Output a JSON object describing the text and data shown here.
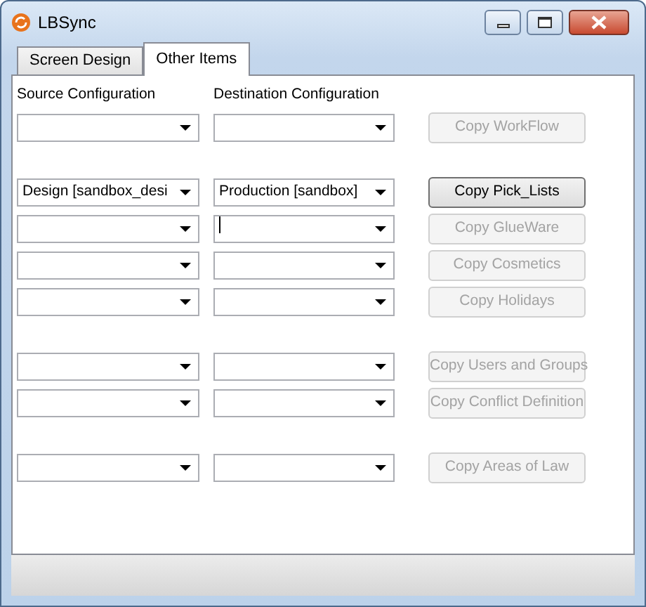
{
  "window": {
    "title": "LBSync"
  },
  "tabs": [
    {
      "label": "Screen Design",
      "selected": false
    },
    {
      "label": "Other Items",
      "selected": true
    }
  ],
  "column_headers": {
    "source": "Source Configuration",
    "destination": "Destination Configuration"
  },
  "groups": [
    {
      "rows": [
        {
          "source": {},
          "destination": {},
          "button": {
            "label": "Copy WorkFlow",
            "disabled": true
          }
        }
      ]
    },
    {
      "rows": [
        {
          "source": {
            "value": "Design [sandbox_desi"
          },
          "destination": {
            "value": "Production [sandbox]"
          },
          "button": {
            "label": "Copy Pick_Lists",
            "disabled": false
          }
        },
        {
          "source": {},
          "destination": {
            "focused": true
          },
          "button": {
            "label": "Copy GlueWare",
            "disabled": true
          }
        },
        {
          "source": {},
          "destination": {},
          "button": {
            "label": "Copy Cosmetics",
            "disabled": true
          }
        },
        {
          "source": {},
          "destination": {},
          "button": {
            "label": "Copy Holidays",
            "disabled": true
          }
        }
      ]
    },
    {
      "rows": [
        {
          "source": {},
          "destination": {},
          "button": {
            "label": "Copy Users and Groups",
            "disabled": true
          }
        },
        {
          "source": {},
          "destination": {},
          "button": {
            "label": "Copy Conflict Definition",
            "disabled": true
          }
        }
      ]
    },
    {
      "rows": [
        {
          "source": {},
          "destination": {},
          "button": {
            "label": "Copy Areas of Law",
            "disabled": true
          }
        }
      ]
    }
  ]
}
